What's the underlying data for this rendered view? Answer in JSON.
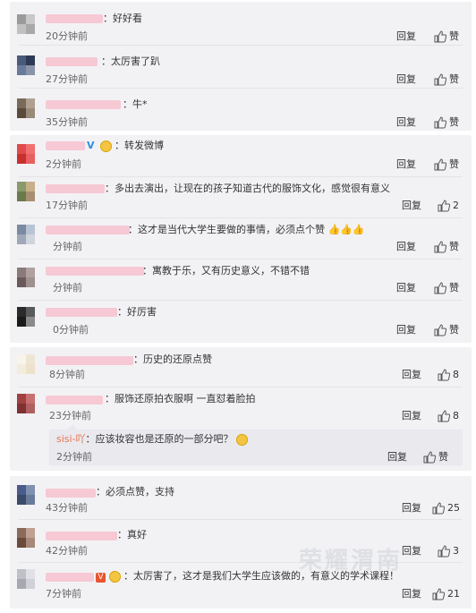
{
  "labels": {
    "reply": "回复",
    "like": "赞"
  },
  "section1": [
    {
      "text": "：好好看",
      "time": "20分钟前",
      "likes": "赞"
    },
    {
      "text": "：太厉害了趴",
      "time": "27分钟前",
      "likes": "赞"
    },
    {
      "text": "：牛*",
      "time": "35分钟前",
      "likes": "赞"
    }
  ],
  "section2": [
    {
      "text": "：转发微博",
      "time": "2分钟前",
      "likes": "赞"
    },
    {
      "text": "：多出去演出，让现在的孩子知道古代的服饰文化，感觉很有意义",
      "time": "17分钟前",
      "likes": "2"
    },
    {
      "text": "：这才是当代大学生要做的事情，必须点个赞",
      "time": "分钟前",
      "likes": "赞"
    },
    {
      "text": "：寓教于乐，又有历史意义，不错不错",
      "time": "分钟前",
      "likes": "赞"
    },
    {
      "text": "：好厉害",
      "time": "0分钟前",
      "likes": "赞"
    }
  ],
  "section3": [
    {
      "text": "：历史的还原点赞",
      "time": "8分钟前",
      "likes": "8"
    },
    {
      "text": "：服饰还原拍衣服啊 一直怼着脸拍",
      "time": "23分钟前",
      "likes": "8"
    }
  ],
  "subreply": {
    "author": "sisi-吖",
    "text": "：应该妆容也是还原的一部分吧？",
    "time": "2分钟前",
    "likes": "赞"
  },
  "section4": [
    {
      "text": "：必须点赞，支持",
      "time": "43分钟前",
      "likes": "25"
    },
    {
      "text": "：真好",
      "time": "42分钟前",
      "likes": "3"
    },
    {
      "text": "：太厉害了，这才是我们大学生应该做的，有意义的学术课程！",
      "time": "7分钟前",
      "likes": "21"
    }
  ],
  "watermark": "荣耀渭南",
  "colors": {
    "panel": "#f2f2f5",
    "name_bar": "#f6c9d4",
    "verified": "#2b8fe0",
    "subreply_name": "#eb7350"
  }
}
